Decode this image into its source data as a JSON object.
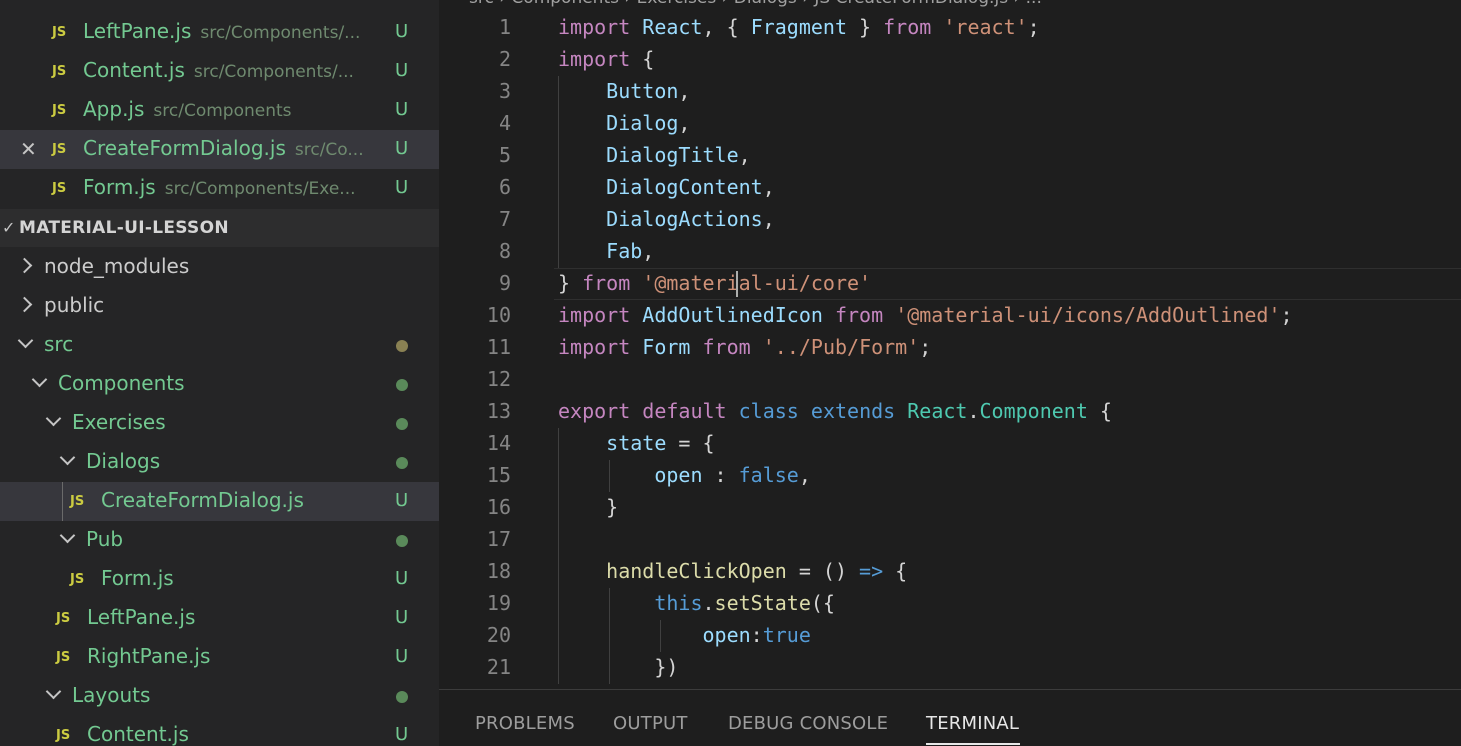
{
  "colors": {
    "modified_green": "#73c991",
    "js_yellow": "#cbcb41",
    "dot_olive": "#8a8153",
    "dot_green": "#5a8a5a"
  },
  "open_editors": [
    {
      "name": "LeftPane.js",
      "path": "src/Components/...",
      "status": "U"
    },
    {
      "name": "Content.js",
      "path": "src/Components/...",
      "status": "U"
    },
    {
      "name": "App.js",
      "path": "src/Components",
      "status": "U"
    },
    {
      "name": "CreateFormDialog.js",
      "path": "src/Co...",
      "status": "U",
      "active": true
    },
    {
      "name": "Form.js",
      "path": "src/Components/Exe...",
      "status": "U"
    }
  ],
  "explorer": {
    "section_title": "MATERIAL-UI-LESSON",
    "items": [
      {
        "label": "node_modules",
        "kind": "folder-collapsed"
      },
      {
        "label": "public",
        "kind": "folder-collapsed"
      },
      {
        "label": "src",
        "kind": "folder-open"
      },
      {
        "label": "Components",
        "kind": "folder-open"
      },
      {
        "label": "Exercises",
        "kind": "folder-open"
      },
      {
        "label": "Dialogs",
        "kind": "folder-open"
      },
      {
        "label": "CreateFormDialog.js",
        "kind": "file",
        "status": "U"
      },
      {
        "label": "Pub",
        "kind": "folder-open"
      },
      {
        "label": "Form.js",
        "kind": "file",
        "status": "U"
      },
      {
        "label": "LeftPane.js",
        "kind": "file",
        "status": "U"
      },
      {
        "label": "RightPane.js",
        "kind": "file",
        "status": "U"
      },
      {
        "label": "Layouts",
        "kind": "folder-open"
      },
      {
        "label": "Content.js",
        "kind": "file",
        "status": "U"
      }
    ],
    "js_icon_label": "JS"
  },
  "editor": {
    "breadcrumb": "src › Components › Exercises › Dialogs › JS CreateFormDialog.js › ...",
    "line_numbers": [
      "1",
      "2",
      "3",
      "4",
      "5",
      "6",
      "7",
      "8",
      "9",
      "10",
      "11",
      "12",
      "13",
      "14",
      "15",
      "16",
      "17",
      "18",
      "19",
      "20",
      "21"
    ],
    "lines": [
      [
        [
          "kw",
          "import"
        ],
        [
          "pn",
          " "
        ],
        [
          "id",
          "React"
        ],
        [
          "pn",
          ", { "
        ],
        [
          "id",
          "Fragment"
        ],
        [
          "pn",
          " } "
        ],
        [
          "kw",
          "from"
        ],
        [
          "pn",
          " "
        ],
        [
          "str",
          "'react'"
        ],
        [
          "pn",
          ";"
        ]
      ],
      [
        [
          "kw",
          "import"
        ],
        [
          "pn",
          " {"
        ]
      ],
      [
        [
          "pn",
          "    "
        ],
        [
          "id",
          "Button"
        ],
        [
          "pn",
          ","
        ]
      ],
      [
        [
          "pn",
          "    "
        ],
        [
          "id",
          "Dialog"
        ],
        [
          "pn",
          ","
        ]
      ],
      [
        [
          "pn",
          "    "
        ],
        [
          "id",
          "DialogTitle"
        ],
        [
          "pn",
          ","
        ]
      ],
      [
        [
          "pn",
          "    "
        ],
        [
          "id",
          "DialogContent"
        ],
        [
          "pn",
          ","
        ]
      ],
      [
        [
          "pn",
          "    "
        ],
        [
          "id",
          "DialogActions"
        ],
        [
          "pn",
          ","
        ]
      ],
      [
        [
          "pn",
          "    "
        ],
        [
          "id",
          "Fab"
        ],
        [
          "pn",
          ","
        ]
      ],
      [
        [
          "pn",
          "} "
        ],
        [
          "kw",
          "from"
        ],
        [
          "pn",
          " "
        ],
        [
          "str",
          "'@material-ui/core'"
        ]
      ],
      [
        [
          "kw",
          "import"
        ],
        [
          "pn",
          " "
        ],
        [
          "id",
          "AddOutlinedIcon"
        ],
        [
          "pn",
          " "
        ],
        [
          "kw",
          "from"
        ],
        [
          "pn",
          " "
        ],
        [
          "str",
          "'@material-ui/icons/AddOutlined'"
        ],
        [
          "pn",
          ";"
        ]
      ],
      [
        [
          "kw",
          "import"
        ],
        [
          "pn",
          " "
        ],
        [
          "id",
          "Form"
        ],
        [
          "pn",
          " "
        ],
        [
          "kw",
          "from"
        ],
        [
          "pn",
          " "
        ],
        [
          "str",
          "'../Pub/Form'"
        ],
        [
          "pn",
          ";"
        ]
      ],
      [],
      [
        [
          "kw",
          "export"
        ],
        [
          "pn",
          " "
        ],
        [
          "kw",
          "default"
        ],
        [
          "pn",
          " "
        ],
        [
          "kb",
          "class"
        ],
        [
          "pn",
          " "
        ],
        [
          "kb",
          "extends"
        ],
        [
          "pn",
          " "
        ],
        [
          "cls",
          "React"
        ],
        [
          "pn",
          "."
        ],
        [
          "cls",
          "Component"
        ],
        [
          "pn",
          " {"
        ]
      ],
      [
        [
          "pn",
          "    "
        ],
        [
          "id",
          "state"
        ],
        [
          "pn",
          " = {"
        ]
      ],
      [
        [
          "pn",
          "        "
        ],
        [
          "id",
          "open"
        ],
        [
          "pn",
          " : "
        ],
        [
          "kb",
          "false"
        ],
        [
          "pn",
          ","
        ]
      ],
      [
        [
          "pn",
          "    }"
        ]
      ],
      [],
      [
        [
          "pn",
          "    "
        ],
        [
          "fn",
          "handleClickOpen"
        ],
        [
          "pn",
          " = () "
        ],
        [
          "kb",
          "=>"
        ],
        [
          "pn",
          " {"
        ]
      ],
      [
        [
          "pn",
          "        "
        ],
        [
          "kb",
          "this"
        ],
        [
          "pn",
          "."
        ],
        [
          "fn",
          "setState"
        ],
        [
          "pn",
          "({"
        ]
      ],
      [
        [
          "pn",
          "            "
        ],
        [
          "id",
          "open"
        ],
        [
          "pn",
          ":"
        ],
        [
          "kb",
          "true"
        ]
      ],
      [
        [
          "pn",
          "        })"
        ]
      ]
    ]
  },
  "panel": {
    "tabs": [
      {
        "label": "PROBLEMS"
      },
      {
        "label": "OUTPUT"
      },
      {
        "label": "DEBUG CONSOLE"
      },
      {
        "label": "TERMINAL",
        "active": true
      }
    ]
  }
}
